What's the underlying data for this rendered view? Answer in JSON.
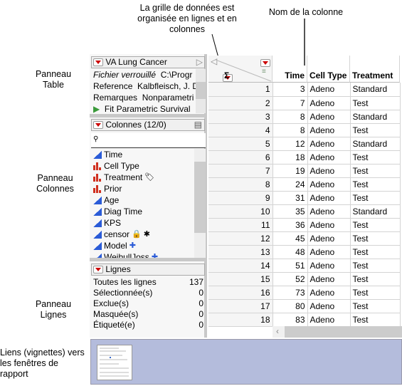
{
  "callouts": {
    "grid": "La grille de données est organisée en lignes et en colonnes",
    "colname": "Nom de la colonne",
    "table_panel": "Panneau Table",
    "cols_panel": "Panneau Colonnes",
    "rows_panel": "Panneau Lignes",
    "links": "Liens (vignettes) vers les fenêtres de rapport"
  },
  "table_panel": {
    "title": "VA Lung Cancer",
    "items": [
      {
        "key": "Fichier verrouillé",
        "value": "C:\\Progr"
      },
      {
        "key": "Reference",
        "value": "Kalbfleisch, J. D"
      },
      {
        "key": "Remarques",
        "value": "Nonparametri"
      },
      {
        "key": "",
        "value": "Fit Parametric Survival"
      }
    ]
  },
  "columns_panel": {
    "title": "Colonnes (12/0)",
    "search_placeholder": "",
    "columns": [
      {
        "name": "Time",
        "type": "continuous",
        "badges": []
      },
      {
        "name": "Cell Type",
        "type": "nominal",
        "badges": []
      },
      {
        "name": "Treatment",
        "type": "nominal",
        "badges": [
          "label-tag-icon"
        ]
      },
      {
        "name": "Prior",
        "type": "nominal",
        "badges": []
      },
      {
        "name": "Age",
        "type": "continuous",
        "badges": []
      },
      {
        "name": "Diag Time",
        "type": "continuous",
        "badges": []
      },
      {
        "name": "KPS",
        "type": "continuous",
        "badges": []
      },
      {
        "name": "censor",
        "type": "continuous",
        "badges": [
          "lock-icon",
          "asterisk-icon"
        ]
      },
      {
        "name": "Model",
        "type": "continuous",
        "badges": [
          "formula-plus-icon"
        ]
      },
      {
        "name": "WeibullJoss",
        "type": "continuous",
        "badges": [
          "formula-plus-icon"
        ]
      }
    ]
  },
  "rows_panel": {
    "title": "Lignes",
    "stats": [
      {
        "label": "Toutes les lignes",
        "value": "137"
      },
      {
        "label": "Sélectionnée(s)",
        "value": "0"
      },
      {
        "label": "Exclue(s)",
        "value": "0"
      },
      {
        "label": "Masquée(s)",
        "value": "0"
      },
      {
        "label": "Étiqueté(e)",
        "value": "0"
      }
    ]
  },
  "grid": {
    "headers": [
      "Time",
      "Cell Type",
      "Treatment"
    ],
    "rows": [
      [
        "1",
        "3",
        "Adeno",
        "Standard"
      ],
      [
        "2",
        "7",
        "Adeno",
        "Test"
      ],
      [
        "3",
        "8",
        "Adeno",
        "Standard"
      ],
      [
        "4",
        "8",
        "Adeno",
        "Test"
      ],
      [
        "5",
        "12",
        "Adeno",
        "Standard"
      ],
      [
        "6",
        "18",
        "Adeno",
        "Test"
      ],
      [
        "7",
        "19",
        "Adeno",
        "Test"
      ],
      [
        "8",
        "24",
        "Adeno",
        "Test"
      ],
      [
        "9",
        "31",
        "Adeno",
        "Test"
      ],
      [
        "10",
        "35",
        "Adeno",
        "Standard"
      ],
      [
        "11",
        "36",
        "Adeno",
        "Test"
      ],
      [
        "12",
        "45",
        "Adeno",
        "Test"
      ],
      [
        "13",
        "48",
        "Adeno",
        "Test"
      ],
      [
        "14",
        "51",
        "Adeno",
        "Test"
      ],
      [
        "15",
        "52",
        "Adeno",
        "Test"
      ],
      [
        "16",
        "73",
        "Adeno",
        "Test"
      ],
      [
        "17",
        "80",
        "Adeno",
        "Test"
      ],
      [
        "18",
        "83",
        "Adeno",
        "Test"
      ]
    ]
  },
  "colors": {
    "thumb_bar": "#b4bcdc",
    "continuous": "#2a5bd7",
    "nominal": "#d03020",
    "menu_red": "#cc0000"
  }
}
